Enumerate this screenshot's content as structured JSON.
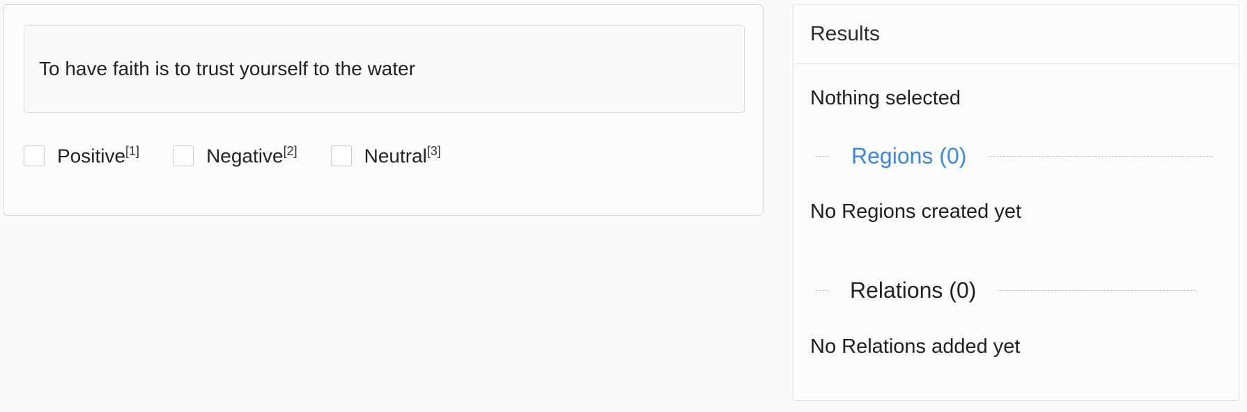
{
  "task": {
    "text": "To have faith is to trust yourself to the water",
    "choices": [
      {
        "label": "Positive",
        "hotkey": "[1]"
      },
      {
        "label": "Negative",
        "hotkey": "[2]"
      },
      {
        "label": "Neutral",
        "hotkey": "[3]"
      }
    ]
  },
  "results": {
    "title": "Results",
    "nothing_selected": "Nothing selected",
    "regions_title": "Regions (0)",
    "regions_empty": "No Regions created yet",
    "relations_title": "Relations (0)",
    "relations_empty": "No Relations added yet"
  },
  "colors": {
    "accent": "#3d87e0",
    "background": "#fafafa",
    "border": "#d6d6d6"
  }
}
